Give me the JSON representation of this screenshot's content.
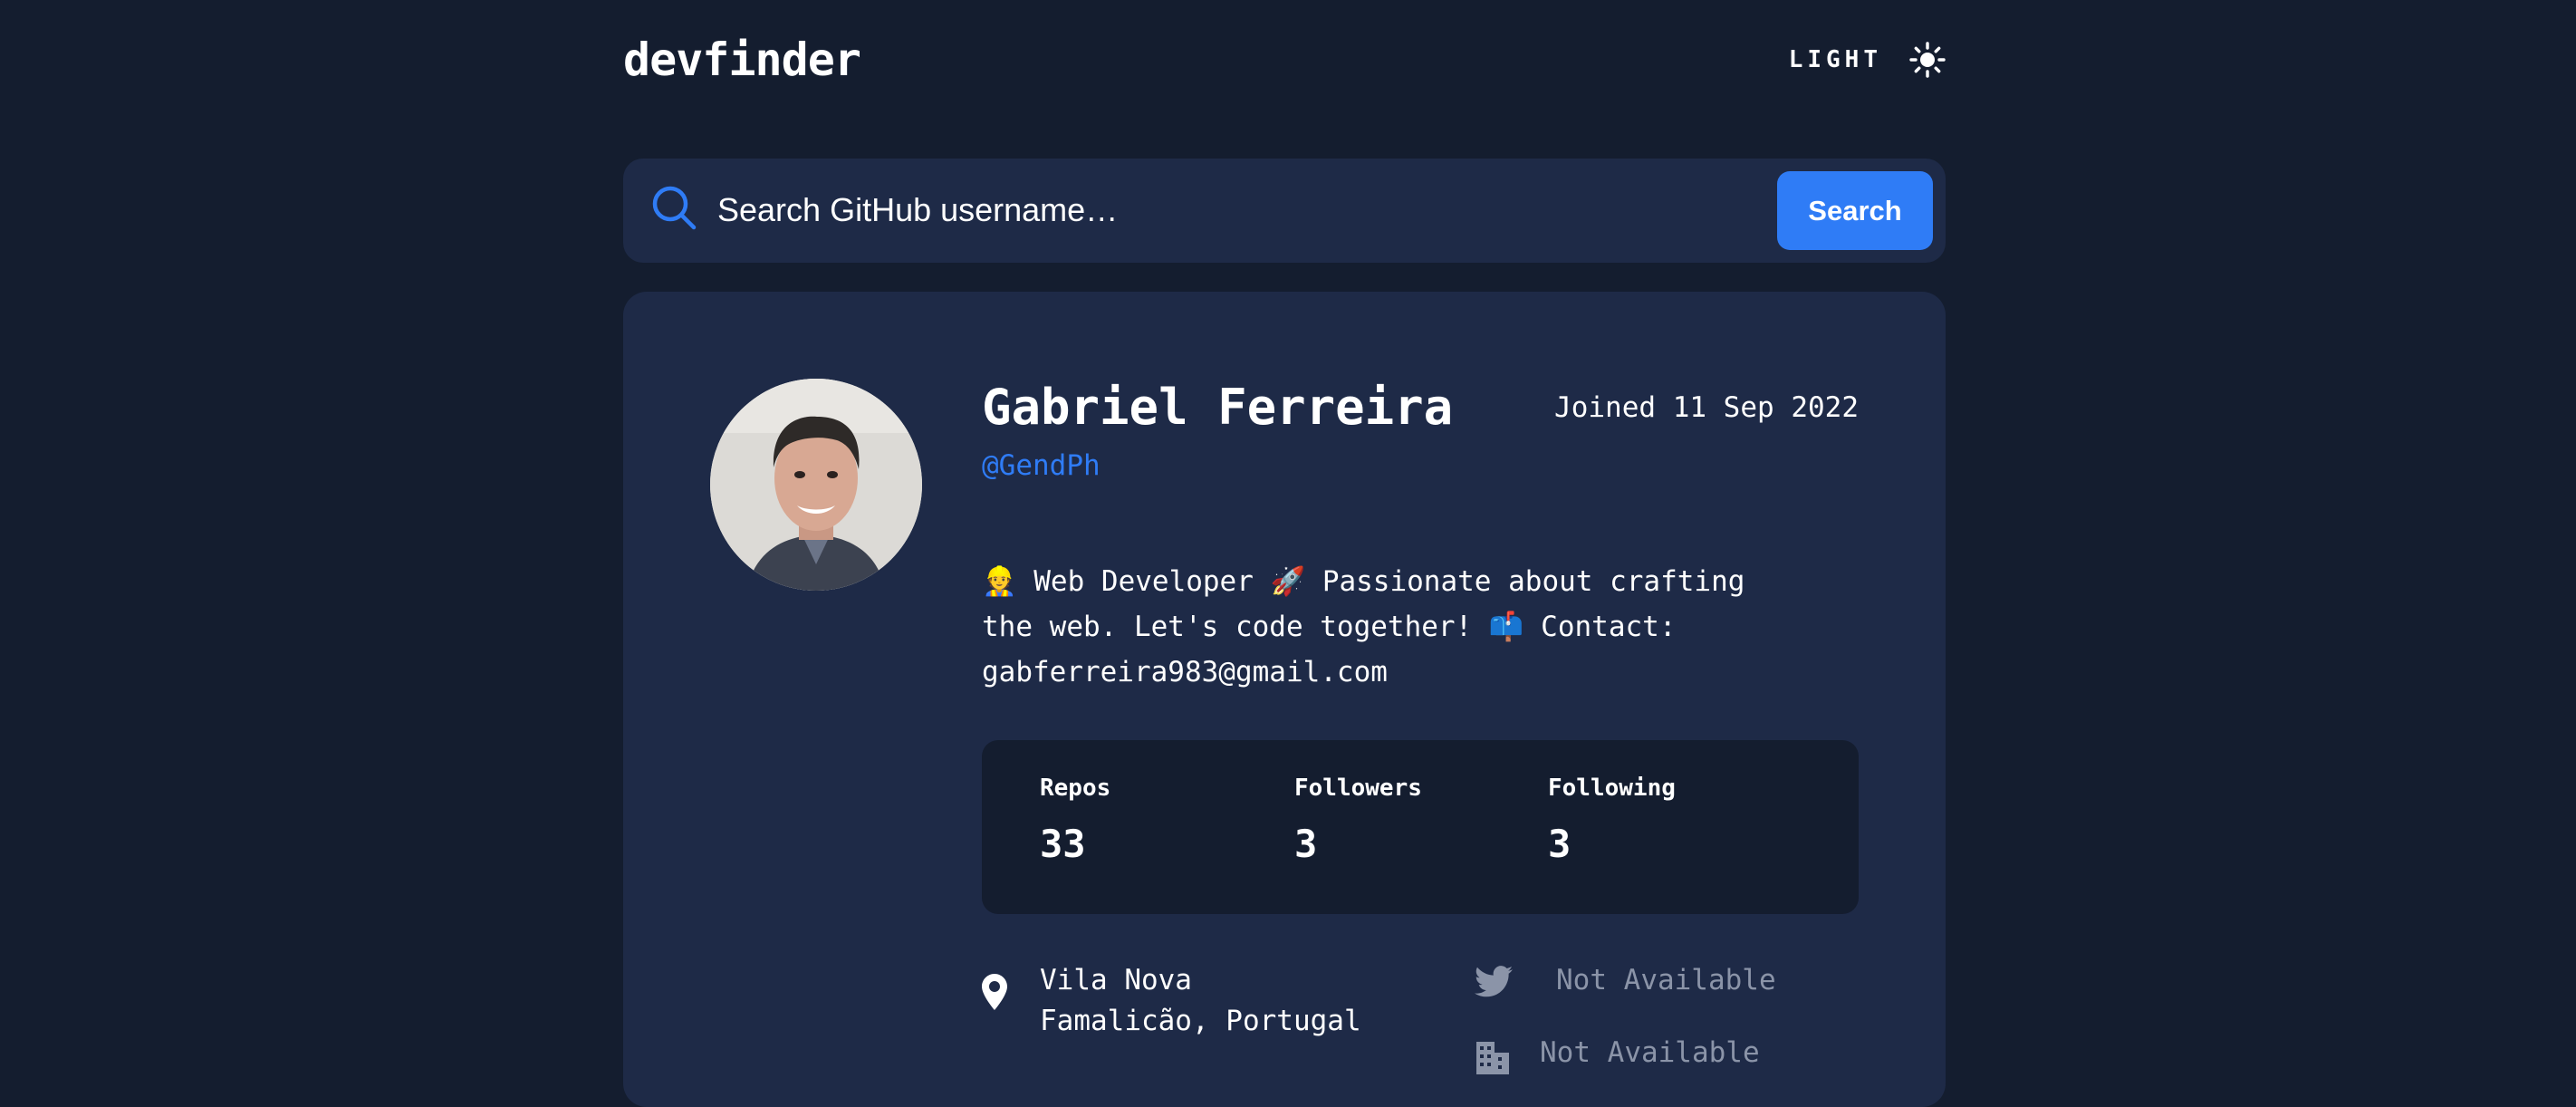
{
  "header": {
    "logo": "devfinder",
    "theme_label": "LIGHT",
    "theme_icon": "sun-icon"
  },
  "search": {
    "placeholder": "Search GitHub username…",
    "value": "",
    "button_label": "Search",
    "icon": "search-icon"
  },
  "profile": {
    "name": "Gabriel Ferreira",
    "login": "@GendPh",
    "joined": "Joined 11 Sep 2022",
    "bio": "👷 Web Developer 🚀 Passionate about crafting the web. Let's code together! 📫 Contact: gabferreira983@gmail.com"
  },
  "stats": {
    "repos": {
      "label": "Repos",
      "value": "33"
    },
    "followers": {
      "label": "Followers",
      "value": "3"
    },
    "following": {
      "label": "Following",
      "value": "3"
    }
  },
  "links": {
    "location": {
      "icon": "location-pin-icon",
      "line1": "Vila Nova",
      "line2": "Famalicão, Portugal"
    },
    "twitter": {
      "icon": "twitter-icon",
      "text": "Not Available"
    },
    "company": {
      "icon": "building-icon",
      "text": "Not Available"
    }
  },
  "colors": {
    "background": "#141d2f",
    "card": "#1e2a47",
    "accent": "#2f7cf6",
    "muted": "#8b94a8"
  }
}
